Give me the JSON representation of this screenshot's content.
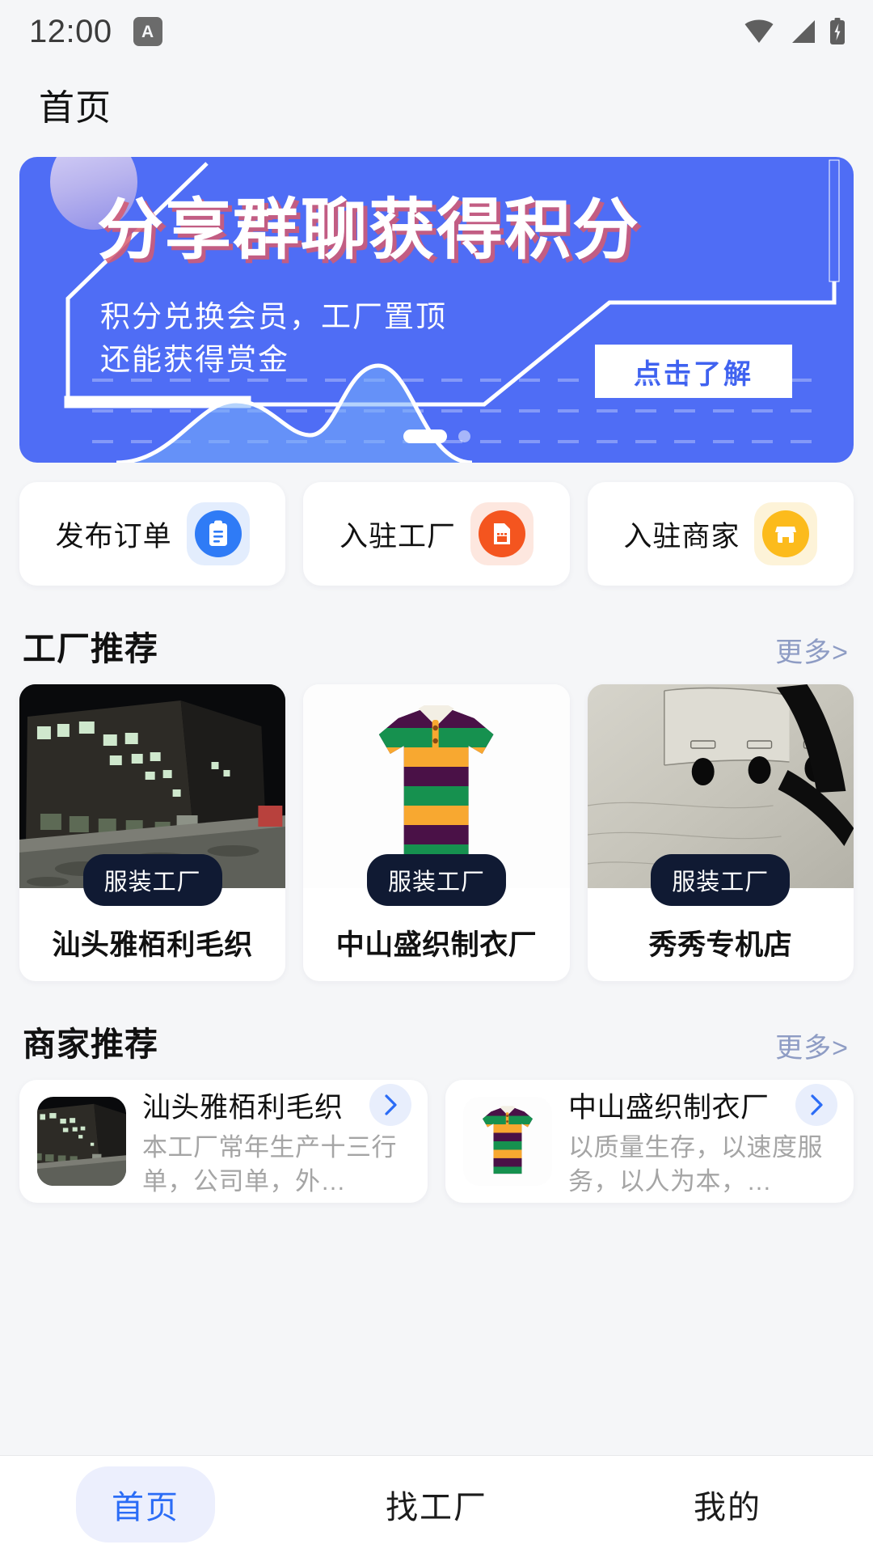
{
  "statusbar": {
    "time": "12:00",
    "app_badge": "A",
    "icons": [
      "wifi-icon",
      "signal-icon",
      "battery-charging-icon"
    ]
  },
  "header": {
    "title": "首页"
  },
  "banner": {
    "headline": "分享群聊获得积分",
    "subline1": "积分兑换会员，工厂置顶",
    "subline2": "还能获得赏金",
    "cta_label": "点击了解",
    "bg_color": "#4f6df5",
    "shadow_color": "#d65a6e",
    "cta_text_color": "#3f62f0",
    "slide_count": 2,
    "active_slide": 1
  },
  "quick_actions": [
    {
      "label": "发布订单",
      "icon": "clipboard-icon",
      "icon_color": "#2f7bf6",
      "icon_bg": "#e3edfd"
    },
    {
      "label": "入驻工厂",
      "icon": "factory-icon",
      "icon_color": "#f4551f",
      "icon_bg": "#fde7df"
    },
    {
      "label": "入驻商家",
      "icon": "shop-icon",
      "icon_color": "#fcbb1c",
      "icon_bg": "#fdf3d8"
    }
  ],
  "factory_section": {
    "title": "工厂推荐",
    "more_label": "更多>",
    "cards": [
      {
        "name": "汕头雅栢利毛织",
        "badge": "服装工厂",
        "photo": "night-factory-building"
      },
      {
        "name": "中山盛织制衣厂",
        "badge": "服装工厂",
        "photo": "striped-polo-shirt"
      },
      {
        "name": "秀秀专机店",
        "badge": "服装工厂",
        "photo": "beige-garment-buttons"
      }
    ]
  },
  "merchant_section": {
    "title": "商家推荐",
    "more_label": "更多>",
    "cards": [
      {
        "name": "汕头雅栢利毛织",
        "desc": "本工厂常年生产十三行单，公司单，外…",
        "photo": "night-factory-building",
        "chevron": "chevron-right-icon"
      },
      {
        "name": "中山盛织制衣厂",
        "desc": "以质量生存，以速度服务，以人为本，…",
        "photo": "striped-polo-shirt",
        "chevron": "chevron-right-icon"
      }
    ]
  },
  "tabbar": {
    "active_index": 0,
    "items": [
      {
        "label": "首页"
      },
      {
        "label": "找工厂"
      },
      {
        "label": "我的"
      }
    ]
  }
}
